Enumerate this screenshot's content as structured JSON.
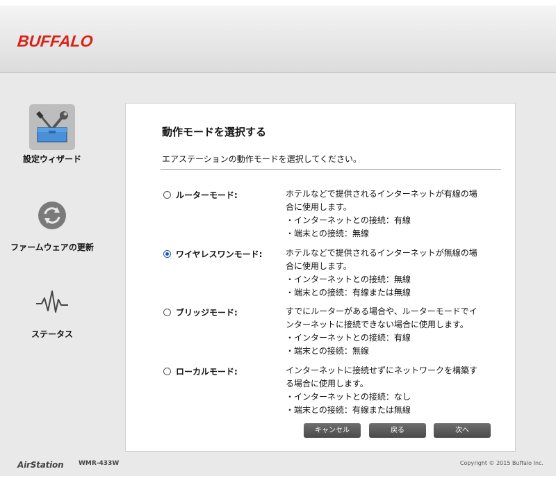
{
  "header": {
    "brand": "BUFFALO"
  },
  "sidebar": {
    "items": [
      {
        "label": "設定ウィザード",
        "icon": "wrench-screwdriver-toolbox-icon",
        "active": true
      },
      {
        "label": "ファームウェアの更新",
        "icon": "refresh-icon",
        "active": false
      },
      {
        "label": "ステータス",
        "icon": "pulse-icon",
        "active": false
      }
    ]
  },
  "panel": {
    "title": "動作モードを選択する",
    "description": "エアステーションの動作モードを選択してください。",
    "modes": [
      {
        "label": "ルーターモード:",
        "checked": false,
        "desc": [
          "ホテルなどで提供されるインターネットが有線の場",
          "合に使用します。",
          "・インターネットとの接続：有線",
          "・端末との接続：無線"
        ]
      },
      {
        "label": "ワイヤレスワンモード:",
        "checked": true,
        "desc": [
          "ホテルなどで提供されるインターネットが無線の場",
          "合に使用します。",
          "・インターネットとの接続：無線",
          "・端末との接続：有線または無線"
        ]
      },
      {
        "label": "ブリッジモード:",
        "checked": false,
        "desc": [
          "すでにルーターがある場合や、ルーターモードでイ",
          "ンターネットに接続できない場合に使用します。",
          "・インターネットとの接続：有線",
          "・端末との接続：無線"
        ]
      },
      {
        "label": "ローカルモード:",
        "checked": false,
        "desc": [
          "インターネットに接続せずにネットワークを構築す",
          "る場合に使用します。",
          "・インターネットとの接続：なし",
          "・端末との接続：有線または無線"
        ]
      }
    ],
    "buttons": {
      "cancel": "キャンセル",
      "back": "戻る",
      "next": "次へ"
    }
  },
  "footer": {
    "product": "AirStation",
    "model": "WMR-433W",
    "copyright": "Copyright © 2015 Buffalo Inc."
  },
  "colors": {
    "brand": "#d8221a",
    "radio_selected": "#1f57b8",
    "toolbox": "#4a90d9"
  }
}
